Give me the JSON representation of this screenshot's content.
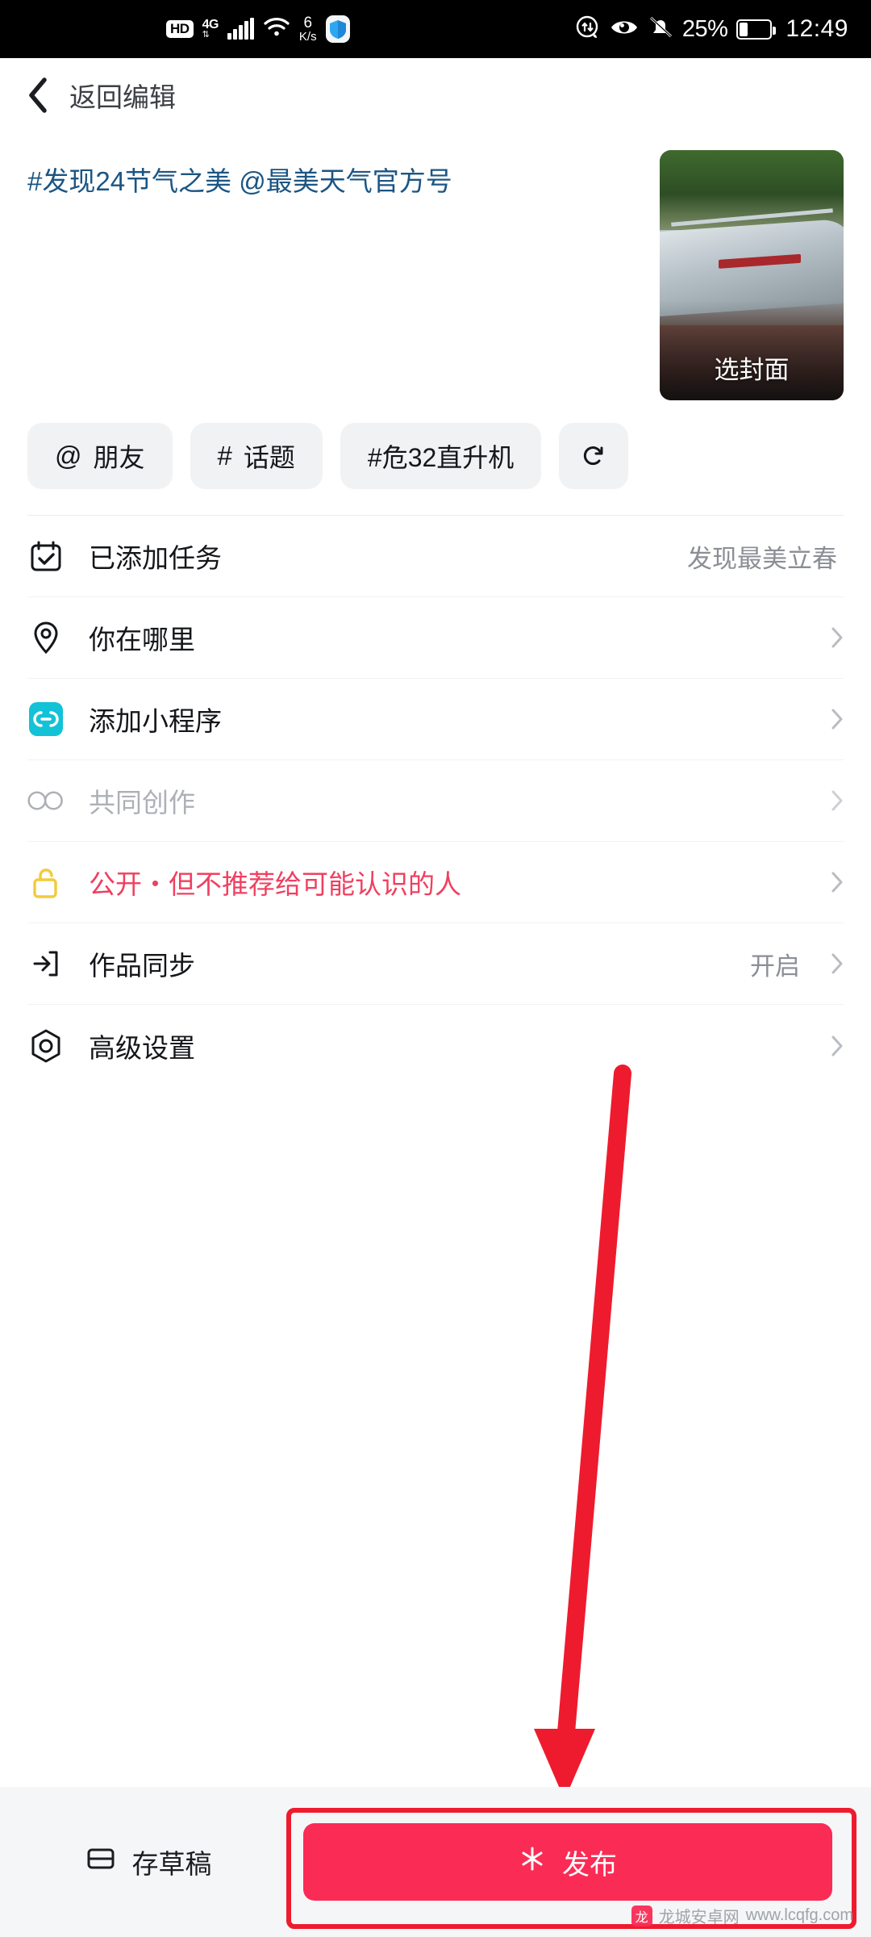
{
  "statusbar": {
    "hd": "HD",
    "network": "4G",
    "net_arrows": "⇅",
    "speed_value": "6",
    "speed_unit": "K/s",
    "shield_icon": "shield-icon",
    "sync_icon": "sync-arrows-icon",
    "eye_icon": "eye-icon",
    "mute_icon": "bell-muted-icon",
    "battery_percent": "25%",
    "time": "12:49"
  },
  "header": {
    "back_icon": "chevron-left-icon",
    "back_label": "返回编辑"
  },
  "compose": {
    "caption": "#发现24节气之美 @最美天气官方号",
    "caption_color": "#1b5583",
    "cover_label": "选封面"
  },
  "chips": [
    {
      "name": "chip-mention-friend",
      "prefix": "@",
      "label": "朋友"
    },
    {
      "name": "chip-topic",
      "prefix": "#",
      "label": "话题"
    },
    {
      "name": "chip-hashtag-ka32",
      "prefix": "",
      "label": "#危32直升机"
    },
    {
      "name": "chip-refresh",
      "prefix": "",
      "label": ""
    }
  ],
  "list": [
    {
      "name": "row-added-task",
      "icon": "calendar-check-icon",
      "label": "已添加任务",
      "value": "发现最美立春",
      "chevron": false,
      "style": "normal"
    },
    {
      "name": "row-location",
      "icon": "location-pin-icon",
      "label": "你在哪里",
      "value": "",
      "chevron": true,
      "style": "normal"
    },
    {
      "name": "row-mini-program",
      "icon": "mini-program-icon",
      "label": "添加小程序",
      "value": "",
      "chevron": true,
      "style": "normal"
    },
    {
      "name": "row-co-creation",
      "icon": "co-icon",
      "label": "共同创作",
      "value": "",
      "chevron": true,
      "style": "muted"
    },
    {
      "name": "row-privacy",
      "icon": "unlock-icon",
      "label": "公开・但不推荐给可能认识的人",
      "value": "",
      "chevron": true,
      "style": "privacy"
    },
    {
      "name": "row-sync",
      "icon": "sync-out-icon",
      "label": "作品同步",
      "value": "开启",
      "chevron": true,
      "style": "normal"
    },
    {
      "name": "row-advanced-settings",
      "icon": "gear-hex-icon",
      "label": "高级设置",
      "value": "",
      "chevron": true,
      "style": "normal"
    }
  ],
  "bottombar": {
    "draft_icon": "save-draft-icon",
    "draft_label": "存草稿",
    "publish_icon": "sparkle-icon",
    "publish_label": "发布",
    "publish_color": "#fa2c55",
    "highlight_color": "#ee1b2e"
  },
  "watermark": {
    "text": "龙城安卓网",
    "sub": "www.lcqfg.com"
  }
}
